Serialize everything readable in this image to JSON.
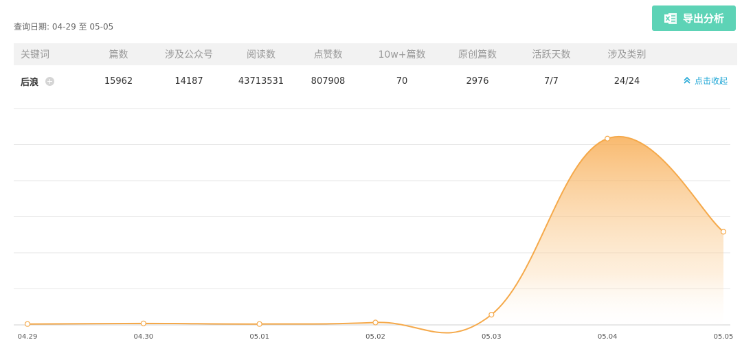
{
  "header": {
    "query_label": "查询日期:",
    "date_range": "04-29 至 05-05",
    "export_label": "导出分析"
  },
  "table": {
    "columns": [
      "关键词",
      "篇数",
      "涉及公众号",
      "阅读数",
      "点赞数",
      "10w+篇数",
      "原创篇数",
      "活跃天数",
      "涉及类别"
    ],
    "row": {
      "keyword": "后浪",
      "articles": "15962",
      "accounts": "14187",
      "reads": "43713531",
      "likes": "807908",
      "over_100k": "70",
      "original": "2976",
      "active_days": "7/7",
      "categories": "24/24",
      "collapse_label": "点击收起"
    }
  },
  "colors": {
    "accent": "#f5a94a",
    "export_button": "#5dd3b6",
    "link": "#21a7d6"
  },
  "chart_data": {
    "type": "area",
    "x": [
      "04.29",
      "04.30",
      "05.01",
      "05.02",
      "05.03",
      "05.04",
      "05.05"
    ],
    "series": [
      {
        "values": [
          30,
          50,
          30,
          80,
          340,
          6200,
          3100
        ]
      }
    ],
    "ylim": [
      0,
      7200
    ],
    "grid": true
  }
}
